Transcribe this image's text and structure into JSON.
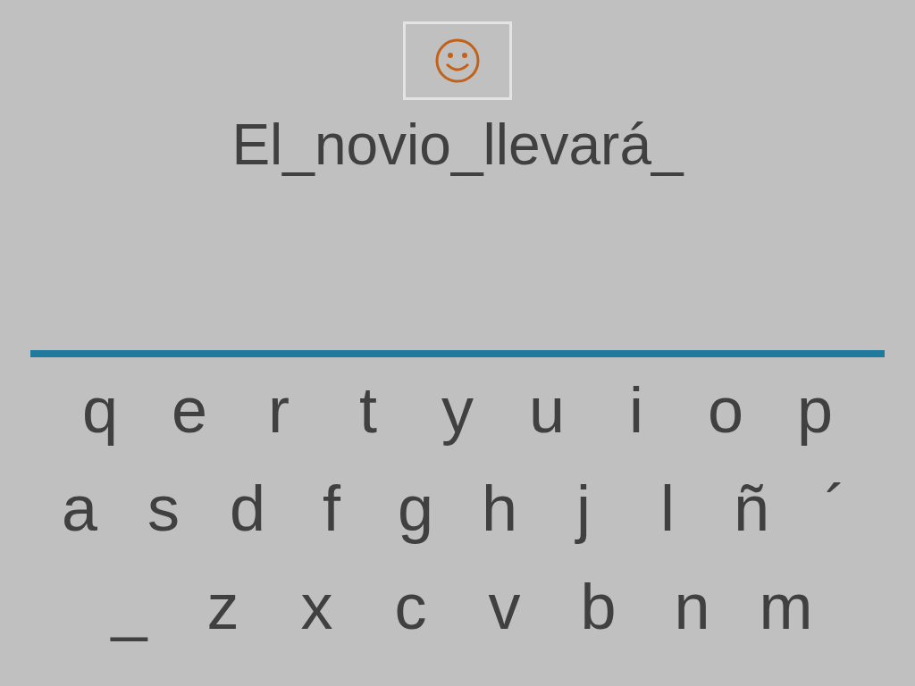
{
  "sentence": "El_novio_llevará_",
  "keyboard_rows": [
    {
      "keys": [
        "q",
        "e",
        "r",
        "t",
        "y",
        "u",
        "i",
        "o",
        "p"
      ]
    },
    {
      "keys": [
        "a",
        "s",
        "d",
        "f",
        "g",
        "h",
        "j",
        "l",
        "ñ",
        "´"
      ]
    },
    {
      "keys": [
        "_",
        "z",
        "x",
        "c",
        "v",
        "b",
        "n",
        "m"
      ]
    }
  ]
}
